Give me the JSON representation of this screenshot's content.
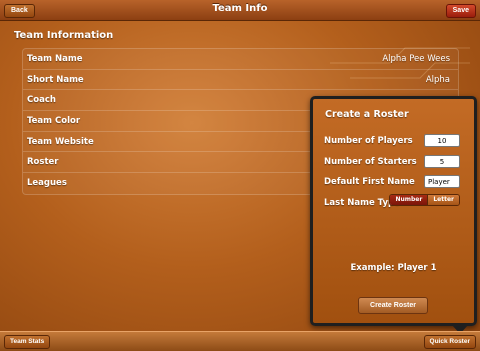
{
  "navbar": {
    "title": "Team Info",
    "back_label": "Back",
    "save_label": "Save"
  },
  "section": {
    "title": "Team Information"
  },
  "team_info": {
    "rows": [
      {
        "label": "Team Name",
        "value": "Alpha Pee Wees"
      },
      {
        "label": "Short Name",
        "value": "Alpha"
      },
      {
        "label": "Coach",
        "value": ""
      },
      {
        "label": "Team Color",
        "value": ""
      },
      {
        "label": "Team Website",
        "value": ""
      },
      {
        "label": "Roster",
        "value": ""
      },
      {
        "label": "Leagues",
        "value": ""
      }
    ]
  },
  "popover": {
    "title": "Create a Roster",
    "num_players_label": "Number of Players",
    "num_players_value": "10",
    "num_starters_label": "Number of Starters",
    "num_starters_value": "5",
    "default_first_name_label": "Default First Name",
    "default_first_name_value": "Player",
    "last_name_type_label": "Last Name Type",
    "segment_number": "Number",
    "segment_letter": "Letter",
    "example_text": "Example: Player 1",
    "create_button_label": "Create Roster"
  },
  "bottombar": {
    "team_stats_label": "Team Stats",
    "quick_roster_label": "Quick Roster"
  },
  "colors": {
    "background": "#b35f1c",
    "popover_border": "#1f1f1f",
    "save_button": "#c0391e",
    "segment_active": "#a82a14"
  }
}
